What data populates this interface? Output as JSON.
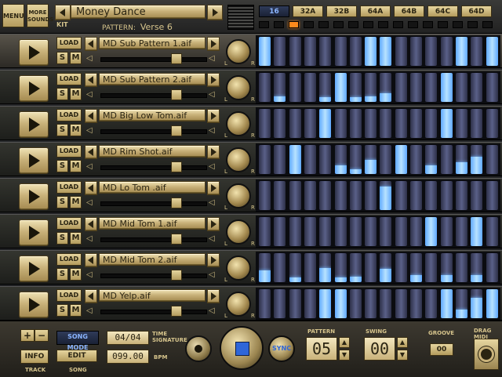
{
  "top": {
    "menu_label": "MENU",
    "more_sounds_label": "MORE SOUNDS",
    "kit_label": "KIT",
    "kit_name": "Money Dance",
    "pattern_label": "PATTERN:",
    "pattern_name": "Verse 6",
    "length_tabs": [
      "16",
      "32A",
      "32B",
      "64A",
      "64B",
      "64C",
      "64D"
    ],
    "active_length_tab": "16",
    "active_step_led": 2
  },
  "tracks": [
    {
      "file": "MD Sub Pattern 1.aif",
      "load": "LOAD",
      "solo": "S",
      "mute": "M",
      "volume": 0.75,
      "steps": [
        1,
        0,
        0,
        0,
        0,
        0,
        0,
        1,
        1,
        0,
        0,
        0,
        0,
        1,
        0,
        1
      ]
    },
    {
      "file": "MD Sub Pattern 2.aif",
      "load": "LOAD",
      "solo": "S",
      "mute": "M",
      "volume": 0.75,
      "steps": [
        0,
        0.2,
        0,
        0,
        0.15,
        1,
        0.15,
        0.2,
        0.3,
        0,
        0,
        0,
        1,
        0,
        0,
        0
      ]
    },
    {
      "file": "MD Big Low Tom.aif",
      "load": "LOAD",
      "solo": "S",
      "mute": "M",
      "volume": 0.75,
      "steps": [
        0,
        0,
        0,
        0,
        1,
        0,
        0,
        0,
        0,
        0,
        0,
        0,
        1,
        0,
        0,
        0
      ]
    },
    {
      "file": "MD Rim Shot.aif",
      "load": "LOAD",
      "solo": "S",
      "mute": "M",
      "volume": 0.75,
      "steps": [
        0,
        0,
        1,
        0,
        0,
        0.3,
        0.15,
        0.5,
        0,
        1,
        0,
        0.3,
        0,
        0.4,
        0.6,
        0
      ]
    },
    {
      "file": "MD Lo Tom .aif",
      "load": "LOAD",
      "solo": "S",
      "mute": "M",
      "volume": 0.75,
      "steps": [
        0,
        0,
        0,
        0,
        0,
        0,
        0,
        0,
        0.8,
        0,
        0,
        0,
        0,
        0,
        0,
        0
      ]
    },
    {
      "file": "MD Mid Tom 1.aif",
      "load": "LOAD",
      "solo": "S",
      "mute": "M",
      "volume": 0.75,
      "steps": [
        0,
        0,
        0,
        0,
        0,
        0,
        0,
        0,
        0,
        0,
        0,
        1,
        0,
        0,
        1,
        0
      ]
    },
    {
      "file": "MD Mid Tom 2.aif",
      "load": "LOAD",
      "solo": "S",
      "mute": "M",
      "volume": 0.75,
      "steps": [
        0.4,
        0,
        0.15,
        0,
        0.5,
        0.15,
        0.2,
        0,
        0.45,
        0,
        0.25,
        0,
        0.25,
        0,
        0.25,
        0
      ]
    },
    {
      "file": "MD Yelp.aif",
      "load": "LOAD",
      "solo": "S",
      "mute": "M",
      "volume": 0.75,
      "steps": [
        0,
        0,
        0,
        0,
        1,
        1,
        0,
        0,
        0,
        0,
        0,
        0,
        1,
        0.3,
        0.7,
        1
      ]
    }
  ],
  "pan_labels": {
    "left": "L",
    "right": "R"
  },
  "selected_track": 0,
  "bottom": {
    "plus": "+",
    "minus": "−",
    "info": "INFO",
    "track_label": "TRACK",
    "song_mode": "SONG MODE",
    "edit": "EDIT",
    "song_label": "SONG",
    "time_signature": "04/04",
    "time_signature_label": "TIME SIGNATURE",
    "bpm": "099.00",
    "bpm_label": "BPM",
    "sync": "SYNC",
    "pattern_label": "PATTERN",
    "pattern_value": "05",
    "swing_label": "SWING",
    "swing_value": "00",
    "groove_label": "GROOVE",
    "groove_value": "00",
    "drag_midi_label": "DRAG MIDI"
  },
  "colors": {
    "step_on": "#8fd0ff",
    "led_on": "#ff8a1c",
    "brass": "#c9b27a",
    "blue_accent": "#2f66d8"
  }
}
